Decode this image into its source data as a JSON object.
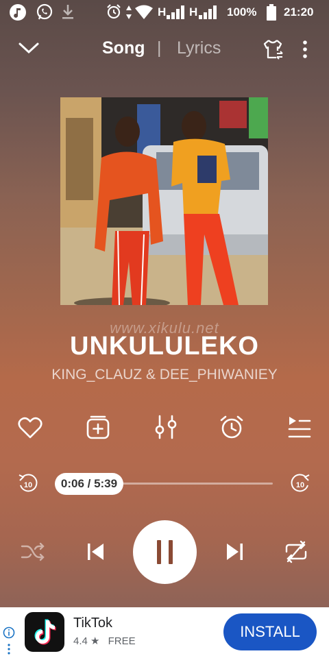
{
  "status_bar": {
    "network_h1": "H",
    "network_h2": "H",
    "battery": "100%",
    "time": "21:20"
  },
  "header": {
    "tab_song": "Song",
    "separator": "|",
    "tab_lyrics": "Lyrics"
  },
  "watermark": "www.xikulu.net",
  "track": {
    "title": "UNKULULEKO",
    "artist": "KING_CLAUZ & DEE_PHIWANIEY"
  },
  "seek": {
    "rewind_label": "10",
    "forward_label": "10",
    "time_display": "0:06 / 5:39",
    "progress_fraction": 0.018
  },
  "ad": {
    "app_name": "TikTok",
    "rating": "4.4 ★",
    "price": "FREE",
    "install_label": "INSTALL"
  },
  "colors": {
    "accent": "#1a56c4",
    "play_button": "#ffffff",
    "pause_icon": "#8a4a34"
  }
}
